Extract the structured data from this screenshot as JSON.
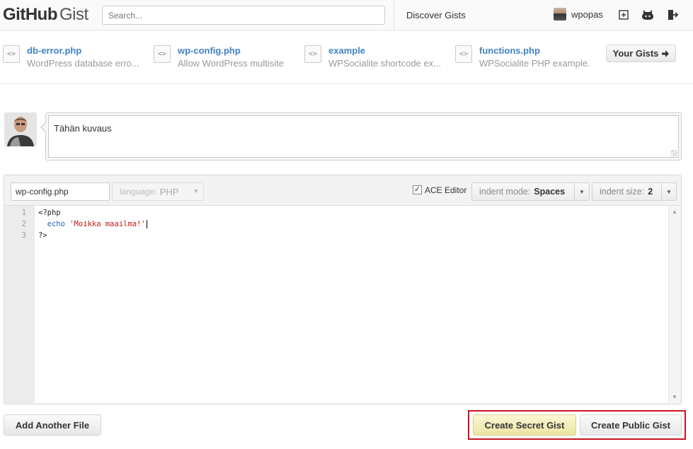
{
  "header": {
    "logo_bold": "GitHub",
    "logo_light": "Gist",
    "search_placeholder": "Search...",
    "discover": "Discover Gists",
    "username": "wpopas"
  },
  "recent": [
    {
      "name": "db-error.php",
      "description": "WordPress database erro..."
    },
    {
      "name": "wp-config.php",
      "description": "Allow WordPress multisite"
    },
    {
      "name": "example",
      "description": "WPSocialite shortcode ex..."
    },
    {
      "name": "functions.php",
      "description": "WPSocialite PHP example."
    }
  ],
  "file_icon_glyph": "<>",
  "your_gists": "Your Gists",
  "description": {
    "value": "Tähän kuvaus"
  },
  "editor": {
    "filename": "wp-config.php",
    "language_label": "language:",
    "language_value": "PHP",
    "ace_label": "ACE Editor",
    "ace_checked": "✓",
    "indent_mode_label": "indent mode:",
    "indent_mode_value": "Spaces",
    "indent_size_label": "indent size:",
    "indent_size_value": "2",
    "line_numbers": [
      "1",
      "2",
      "3"
    ],
    "code": {
      "line1": "<?php",
      "line2_keyword": "echo",
      "line2_string": "'Moikka maailma!'",
      "line3": "?>"
    }
  },
  "footer": {
    "add_file": "Add Another File",
    "create_secret": "Create Secret Gist",
    "create_public": "Create Public Gist"
  },
  "colors": {
    "link": "#4183c4",
    "highlight": "#c9151e",
    "secret_button": "#ece5a3"
  }
}
